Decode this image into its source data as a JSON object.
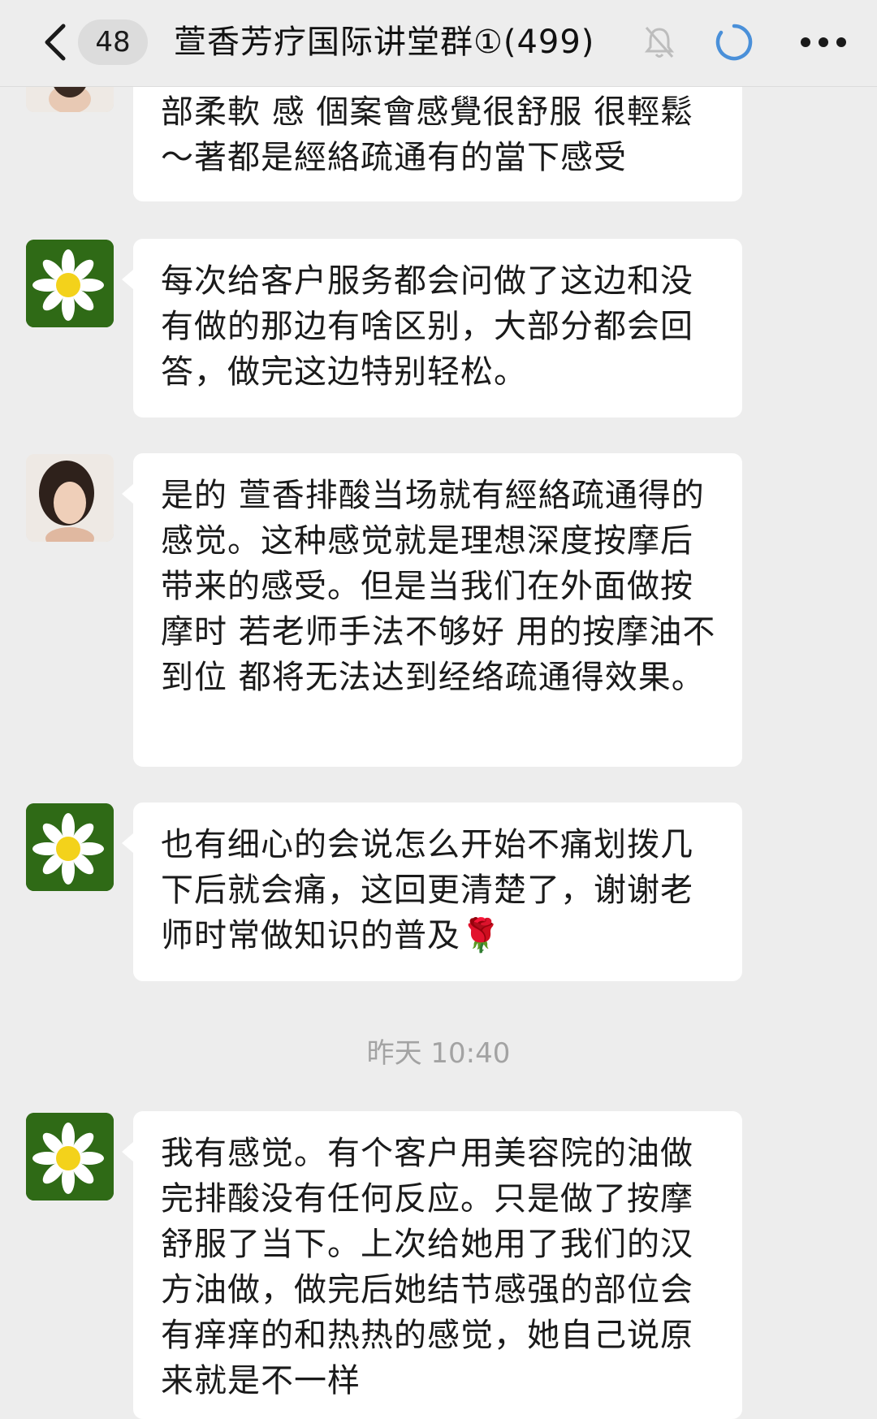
{
  "header": {
    "unread_count": "48",
    "title": "萱香芳疗国际讲堂群①(499)"
  },
  "messages": [
    {
      "sender": "woman",
      "text": "部柔軟 感 個案會感覺很舒服 很輕鬆～著都是經絡疏通有的當下感受"
    },
    {
      "sender": "daisy",
      "text": "每次给客户服务都会问做了这边和没有做的那边有啥区别，大部分都会回答，做完这边特别轻松。"
    },
    {
      "sender": "woman",
      "text": "是的 萱香排酸当场就有經絡疏通得的感觉。这种感觉就是理想深度按摩后 带来的感受。但是当我们在外面做按摩时 若老师手法不够好 用的按摩油不到位 都将无法达到经络疏通得效果。"
    },
    {
      "sender": "daisy",
      "text": "也有细心的会说怎么开始不痛划拨几下后就会痛，这回更清楚了，谢谢老师时常做知识的普及🌹"
    },
    {
      "sender": "daisy",
      "text": "我有感觉。有个客户用美容院的油做完排酸没有任何反应。只是做了按摩舒服了当下。上次给她用了我们的汉方油做，做完后她结节感强的部位会有痒痒的和热热的感觉，她自己说原来就是不一样"
    }
  ],
  "timestamp": "昨天 10:40",
  "icons": {
    "back": "chevron-left-icon",
    "mute": "bell-muted-icon",
    "loading": "loading-spinner-icon",
    "more": "more-dots-icon"
  },
  "colors": {
    "background": "#ededed",
    "bubble": "#ffffff",
    "spinner": "#4a90d9"
  }
}
